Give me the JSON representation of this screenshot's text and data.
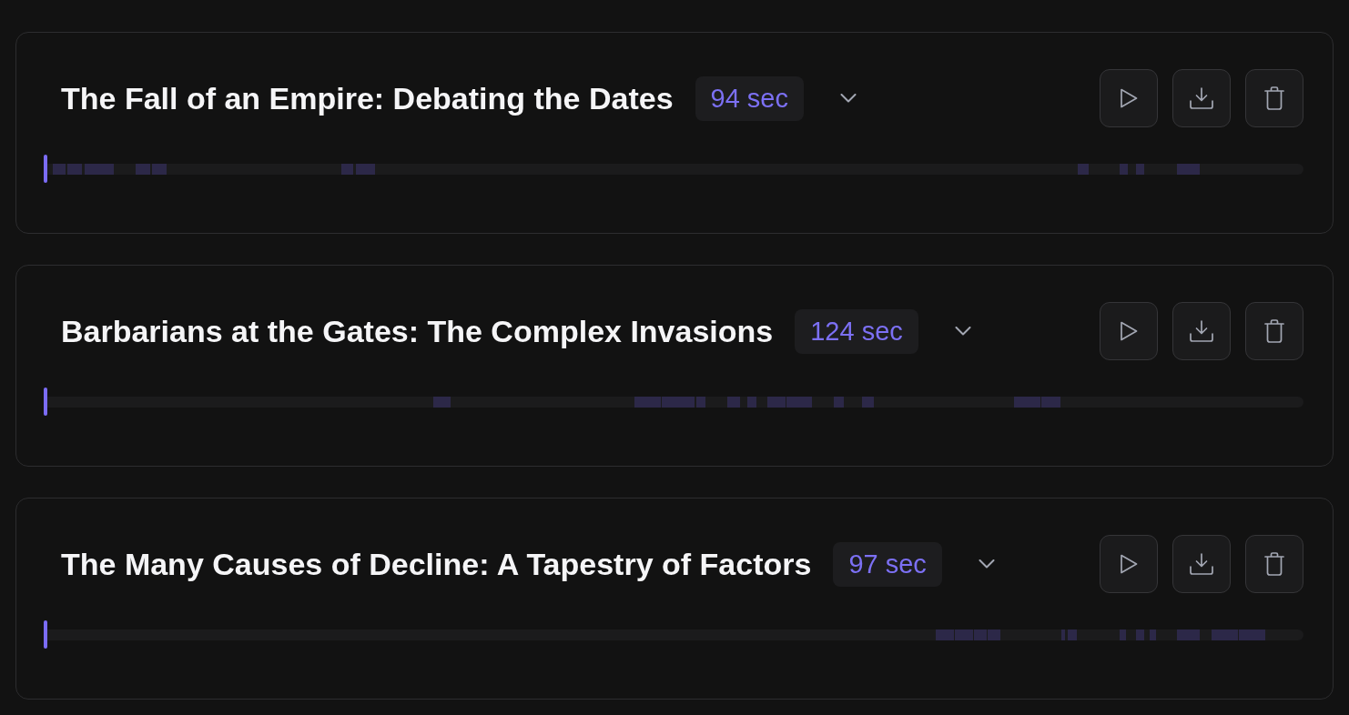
{
  "recordings": [
    {
      "title": "The Fall of an Empire: Debating the Dates",
      "duration": "94 sec",
      "expanded": false,
      "playback": {
        "level": 0
      }
    },
    {
      "title": "Barbarians at the Gates: The Complex Invasions",
      "duration": "124 sec",
      "expanded": false,
      "playback": {
        "level": 0
      }
    },
    {
      "title": "The Many Causes of Decline: A Tapestry of Factors",
      "duration": "97 sec",
      "expanded": false,
      "playback": {
        "level": 0
      }
    }
  ]
}
